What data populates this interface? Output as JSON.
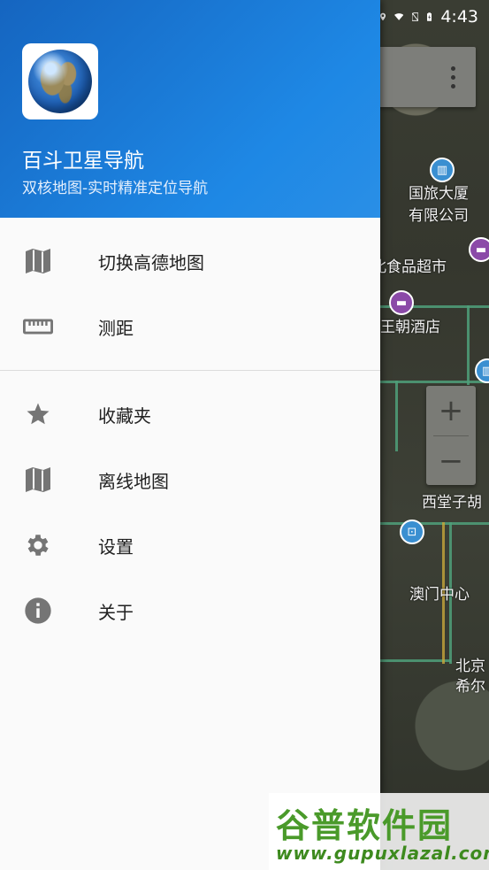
{
  "status_bar": {
    "time": "4:43",
    "icons": [
      "location-icon",
      "wifi-icon",
      "no-sim-icon",
      "battery-charging-icon"
    ]
  },
  "drawer": {
    "app_name": "百斗卫星导航",
    "app_subtitle": "双核地图-实时精准定位导航",
    "menu_primary": [
      {
        "label": "切换高德地图",
        "icon": "map-icon"
      },
      {
        "label": "测距",
        "icon": "ruler-icon"
      }
    ],
    "menu_secondary": [
      {
        "label": "收藏夹",
        "icon": "star-icon"
      },
      {
        "label": "离线地图",
        "icon": "map-icon"
      },
      {
        "label": "设置",
        "icon": "gear-icon"
      },
      {
        "label": "关于",
        "icon": "info-icon"
      }
    ]
  },
  "map": {
    "labels": [
      "国旅大厦",
      "有限公司",
      "北食品超市",
      "王朝酒店",
      "西堂子胡",
      "澳门中心",
      "北京",
      "希尔"
    ],
    "zoom_in": "+",
    "zoom_out": "−"
  },
  "watermark": {
    "title": "谷普软件园",
    "url": "www.gupuxlazal.com"
  },
  "colors": {
    "header_blue": "#1e88e5",
    "icon_gray": "#757575",
    "road_green": "#4fa07a"
  }
}
